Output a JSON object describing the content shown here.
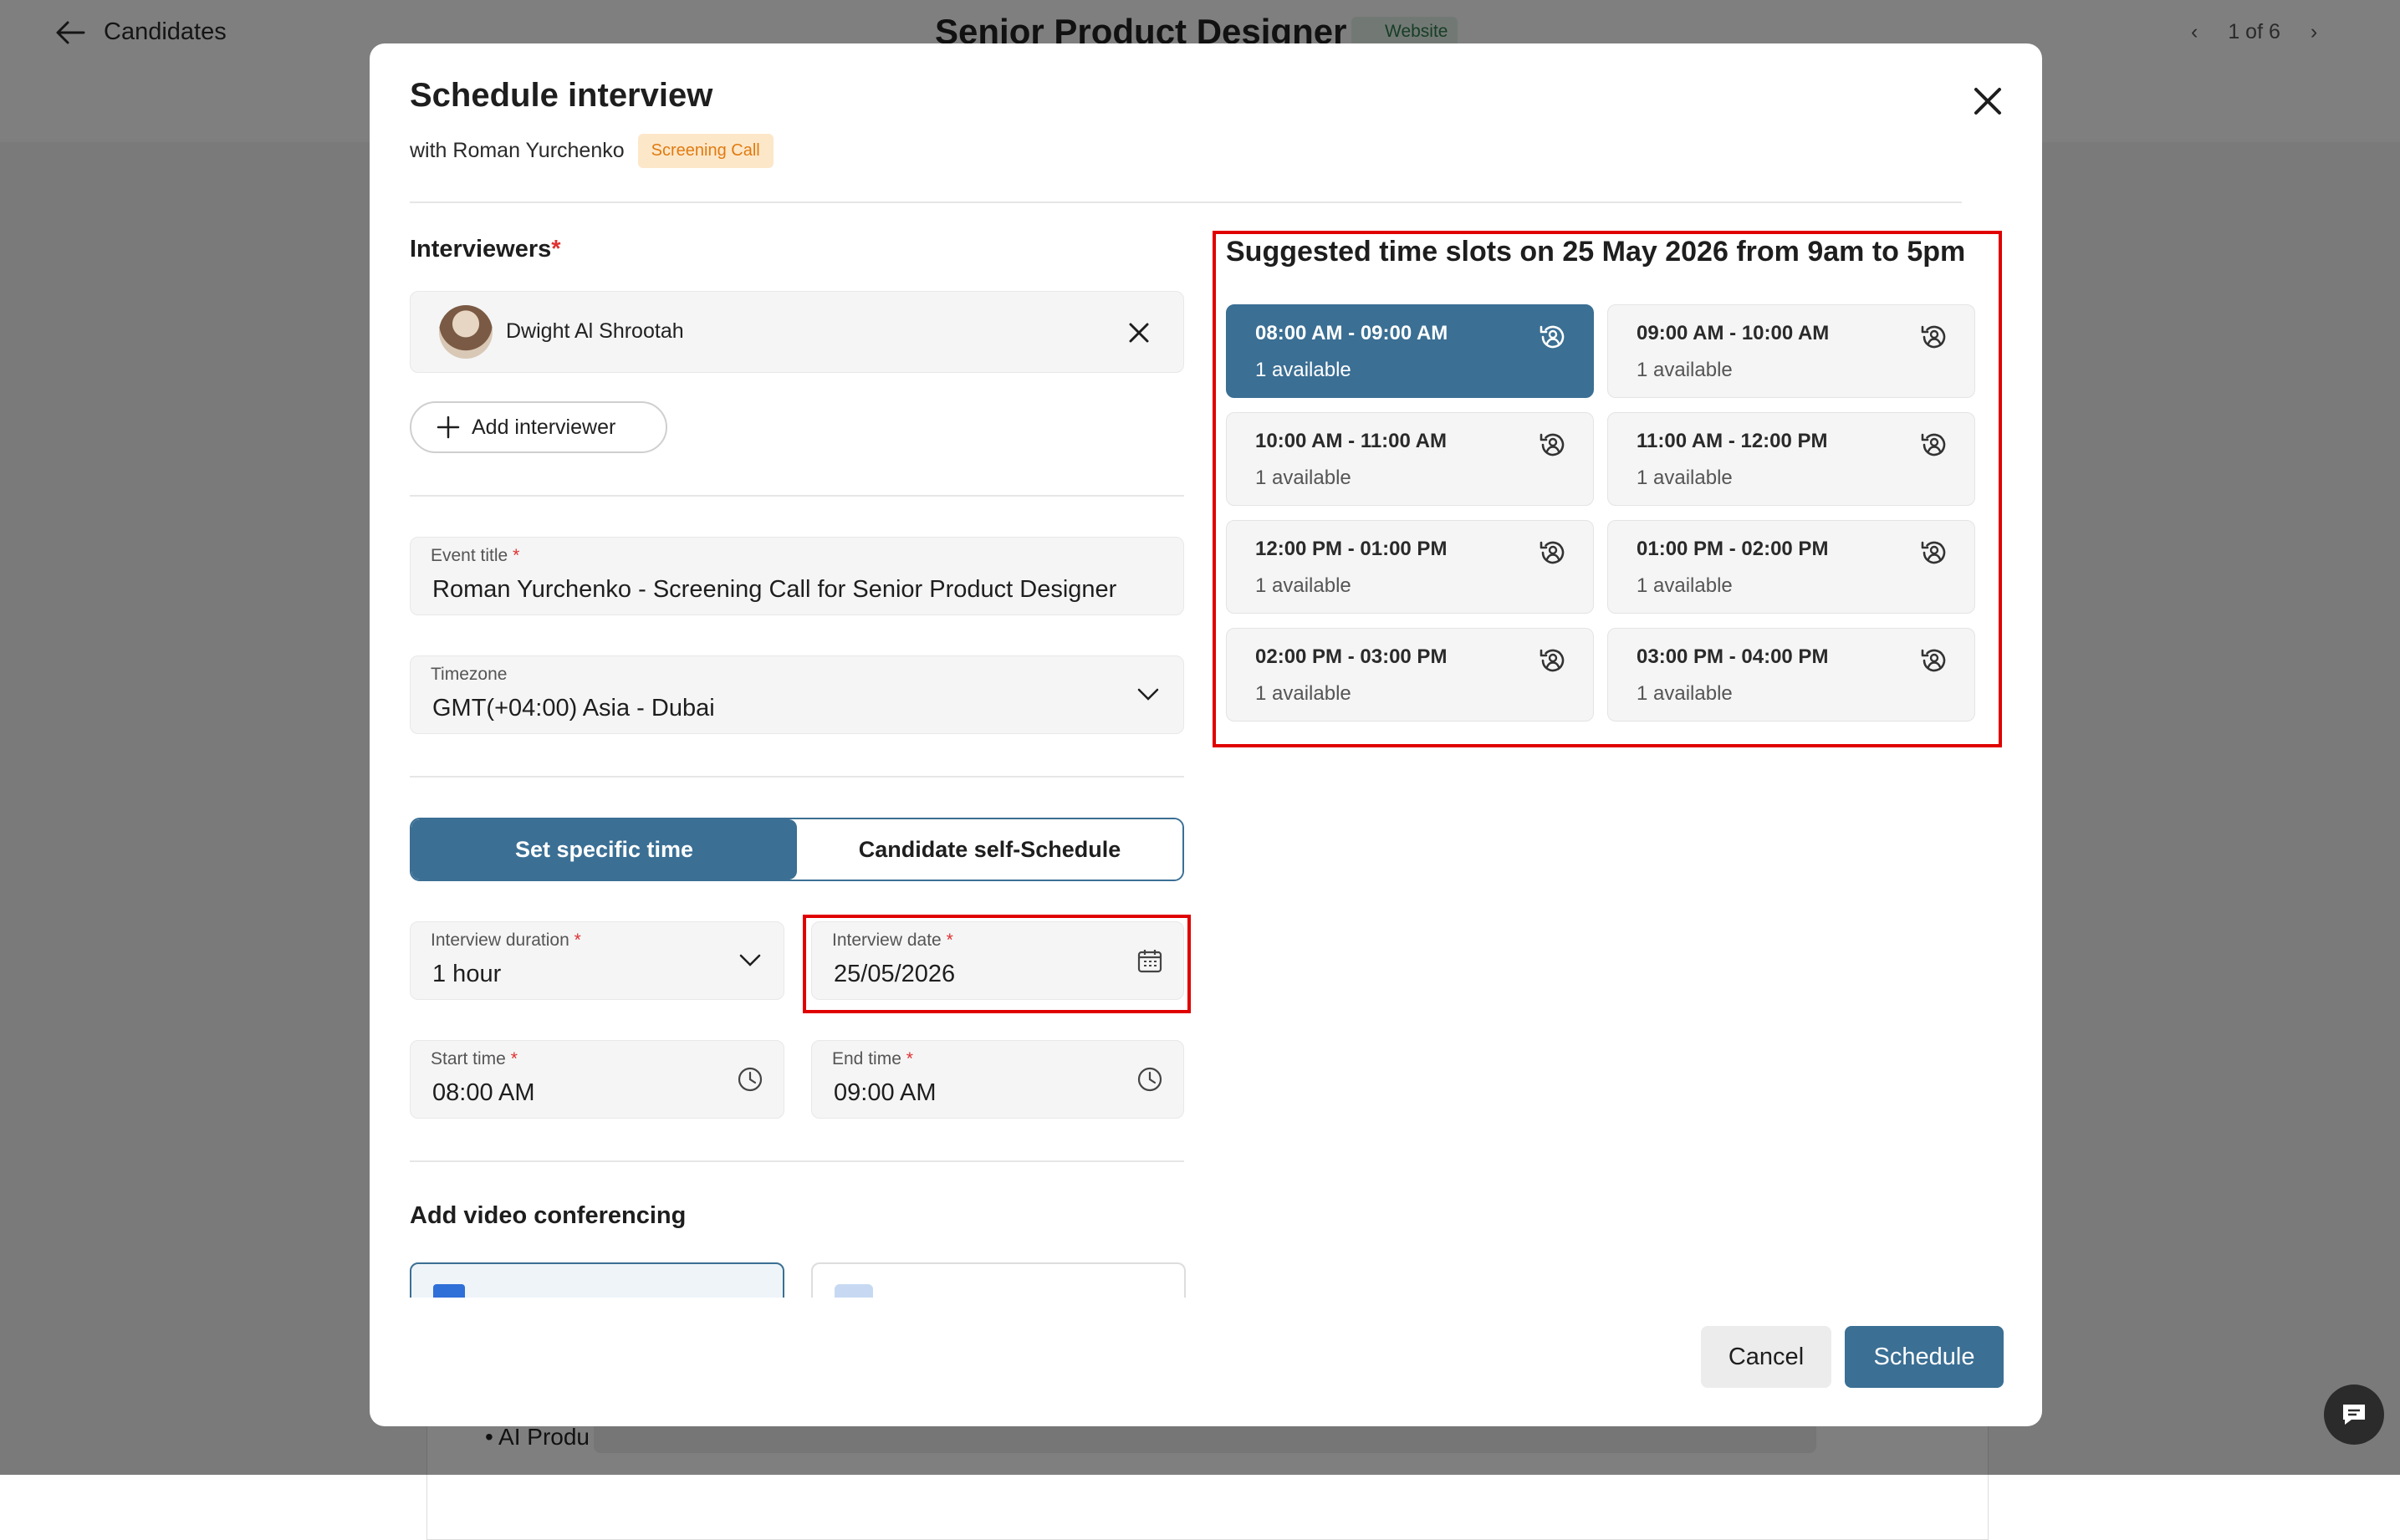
{
  "background": {
    "back_label": "Candidates",
    "job_title": "Senior Product Designer",
    "source_badge": "Website",
    "pager": "1 of 6",
    "bullet_text": "AI Produ"
  },
  "modal": {
    "title": "Schedule interview",
    "with_text": "with Roman Yurchenko",
    "stage_badge": "Screening Call",
    "interviewers_label": "Interviewers",
    "required_mark": "*",
    "interviewer_name": "Dwight Al Shrootah",
    "add_interviewer_label": "Add interviewer",
    "event_title": {
      "label": "Event title",
      "value": "Roman Yurchenko - Screening Call for Senior Product Designer"
    },
    "timezone": {
      "label": "Timezone",
      "value": "GMT(+04:00) Asia - Dubai"
    },
    "mode_toggle": {
      "specific": "Set specific time",
      "self": "Candidate self-Schedule",
      "selected": "specific"
    },
    "duration": {
      "label": "Interview duration",
      "value": "1 hour"
    },
    "date": {
      "label": "Interview date",
      "value": "25/05/2026"
    },
    "start_time": {
      "label": "Start time",
      "value": "08:00 AM"
    },
    "end_time": {
      "label": "End time",
      "value": "09:00 AM"
    },
    "video_label": "Add video conferencing",
    "cancel_label": "Cancel",
    "schedule_label": "Schedule"
  },
  "slots": {
    "title": "Suggested time slots on 25 May 2026 from 9am to 5pm",
    "items": [
      {
        "time": "08:00 AM - 09:00 AM",
        "avail": "1 available",
        "selected": true
      },
      {
        "time": "09:00 AM - 10:00 AM",
        "avail": "1 available",
        "selected": false
      },
      {
        "time": "10:00 AM - 11:00 AM",
        "avail": "1 available",
        "selected": false
      },
      {
        "time": "11:00 AM - 12:00 PM",
        "avail": "1 available",
        "selected": false
      },
      {
        "time": "12:00 PM - 01:00 PM",
        "avail": "1 available",
        "selected": false
      },
      {
        "time": "01:00 PM - 02:00 PM",
        "avail": "1 available",
        "selected": false
      },
      {
        "time": "02:00 PM - 03:00 PM",
        "avail": "1 available",
        "selected": false
      },
      {
        "time": "03:00 PM - 04:00 PM",
        "avail": "1 available",
        "selected": false
      }
    ]
  },
  "colors": {
    "primary": "#3b6f94",
    "highlight": "#e00000",
    "badge_bg": "#fde7c9",
    "badge_text": "#e07b10"
  }
}
